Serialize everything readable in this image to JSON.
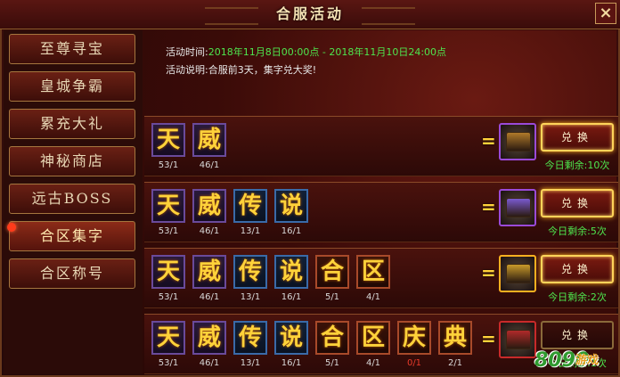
{
  "window": {
    "title": "合服活动",
    "close_label": "×"
  },
  "sidebar": {
    "items": [
      {
        "label": "至尊寻宝",
        "active": false
      },
      {
        "label": "皇城争霸",
        "active": false
      },
      {
        "label": "累充大礼",
        "active": false
      },
      {
        "label": "神秘商店",
        "active": false
      },
      {
        "label": "远古BOSS",
        "active": false
      },
      {
        "label": "合区集字",
        "active": true
      },
      {
        "label": "合区称号",
        "active": false
      }
    ]
  },
  "info": {
    "time_label": "活动时间:",
    "time_value": "2018年11月8日00:00点 - 2018年11月10日24:00点",
    "desc_label": "活动说明:",
    "desc_value": "合服前3天，集字兑大奖!"
  },
  "rows": [
    {
      "chars": [
        {
          "char": "天",
          "count": "53/1"
        },
        {
          "char": "威",
          "count": "46/1"
        }
      ],
      "equals": "=",
      "button": "兑换",
      "remain": "今日剩余:10次"
    },
    {
      "chars": [
        {
          "char": "天",
          "count": "53/1"
        },
        {
          "char": "威",
          "count": "46/1"
        },
        {
          "char": "传",
          "count": "13/1"
        },
        {
          "char": "说",
          "count": "16/1"
        }
      ],
      "equals": "=",
      "button": "兑换",
      "remain": "今日剩余:5次"
    },
    {
      "chars": [
        {
          "char": "天",
          "count": "53/1"
        },
        {
          "char": "威",
          "count": "46/1"
        },
        {
          "char": "传",
          "count": "13/1"
        },
        {
          "char": "说",
          "count": "16/1"
        },
        {
          "char": "合",
          "count": "5/1"
        },
        {
          "char": "区",
          "count": "4/1"
        }
      ],
      "equals": "=",
      "button": "兑换",
      "remain": "今日剩余:2次"
    },
    {
      "chars": [
        {
          "char": "天",
          "count": "53/1"
        },
        {
          "char": "威",
          "count": "46/1"
        },
        {
          "char": "传",
          "count": "13/1"
        },
        {
          "char": "说",
          "count": "16/1"
        },
        {
          "char": "合",
          "count": "5/1"
        },
        {
          "char": "区",
          "count": "4/1"
        },
        {
          "char": "庆",
          "count": "0/1"
        },
        {
          "char": "典",
          "count": "2/1"
        }
      ],
      "equals": "=",
      "button": "兑换",
      "remain": "今日剩余:1次"
    }
  ],
  "watermark": {
    "number": "8090",
    "text": "游戏"
  },
  "colors": {
    "char_gold": "#ffd23a",
    "remain_green": "#4ee64e",
    "count_bad": "#e83a2a"
  }
}
